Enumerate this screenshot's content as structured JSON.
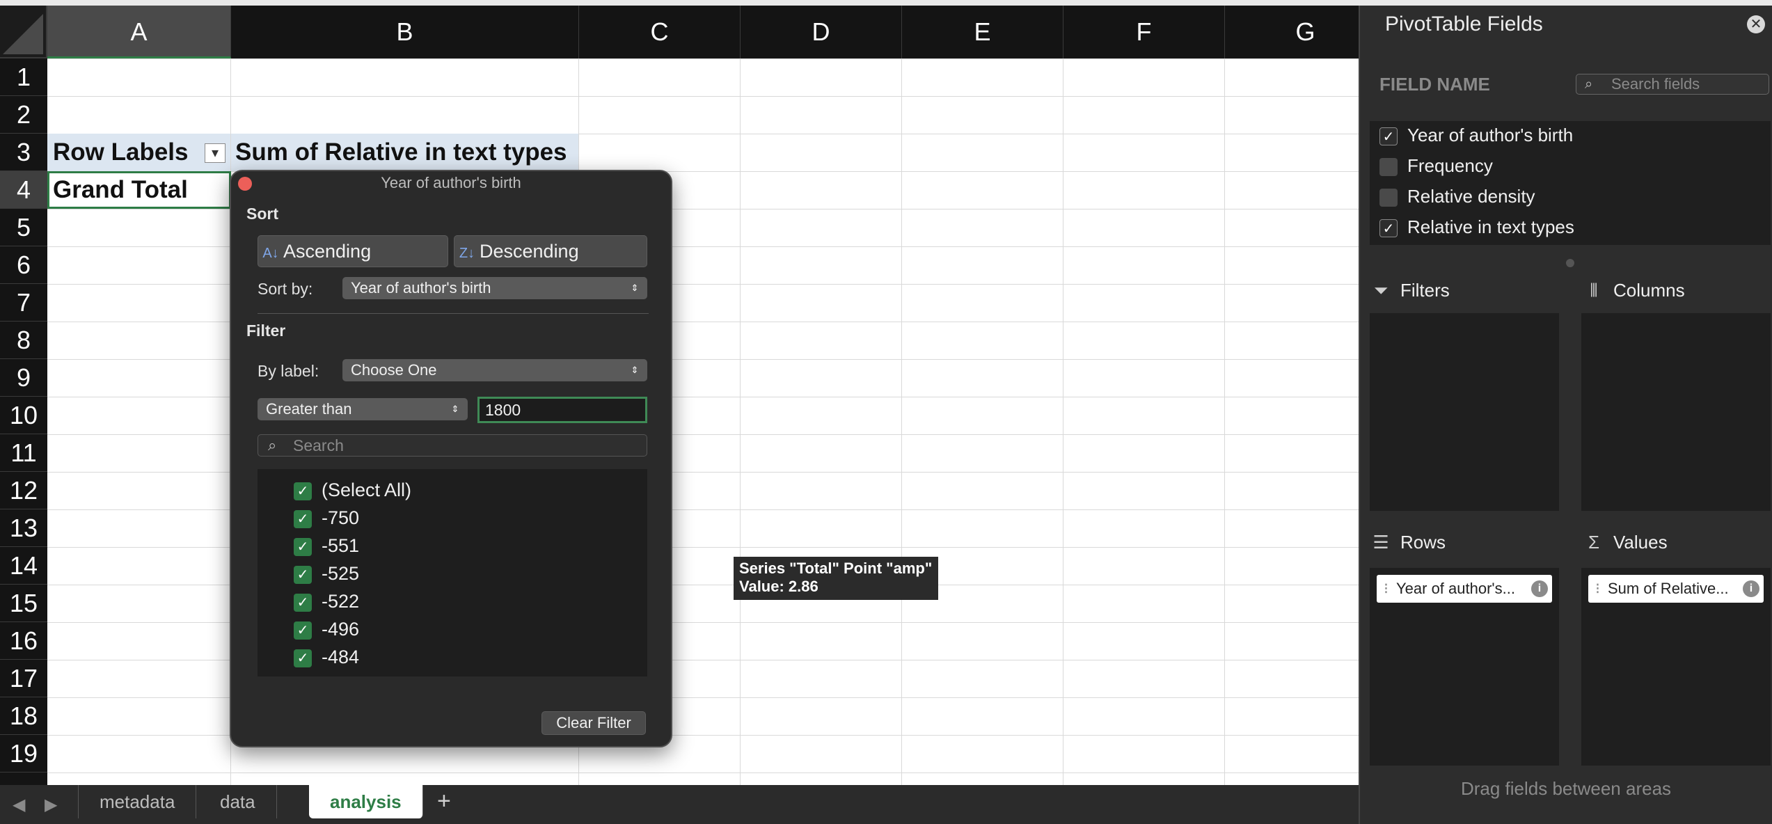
{
  "sheet": {
    "columns": [
      "A",
      "B",
      "C",
      "D",
      "E",
      "F",
      "G"
    ],
    "selected_column": "A",
    "rows": [
      "1",
      "2",
      "3",
      "4",
      "5",
      "6",
      "7",
      "8",
      "9",
      "10",
      "11",
      "12",
      "13",
      "14",
      "15",
      "16",
      "17",
      "18",
      "19"
    ],
    "selected_row": "4",
    "cells": {
      "a3": "Row Labels",
      "b3": "Sum of Relative in text types",
      "a4": "Grand Total"
    }
  },
  "tabs": {
    "items": [
      "metadata",
      "data",
      "analysis"
    ],
    "active": "analysis",
    "add_label": "+"
  },
  "filter_popup": {
    "title": "Year of author's birth",
    "sort_label": "Sort",
    "ascending_label": "Ascending",
    "descending_label": "Descending",
    "sort_by_label": "Sort by:",
    "sort_by_value": "Year of author's birth",
    "filter_label": "Filter",
    "by_label_label": "By label:",
    "by_label_value": "Choose One",
    "condition_value": "Greater than",
    "condition_input": "1800",
    "search_placeholder": "Search",
    "items": [
      {
        "label": "(Select All)",
        "checked": true
      },
      {
        "label": "-750",
        "checked": true
      },
      {
        "label": "-551",
        "checked": true
      },
      {
        "label": "-525",
        "checked": true
      },
      {
        "label": "-522",
        "checked": true
      },
      {
        "label": "-496",
        "checked": true
      },
      {
        "label": "-484",
        "checked": true
      }
    ],
    "clear_filter_label": "Clear Filter"
  },
  "tooltip": {
    "line1": "Series \"Total\" Point \"amp\"",
    "line2": "Value: 2.86"
  },
  "pivot_pane": {
    "title": "PivotTable Fields",
    "field_name_label": "FIELD NAME",
    "search_placeholder": "Search fields",
    "fields": [
      {
        "label": "Year of author's birth",
        "checked": true
      },
      {
        "label": "Frequency",
        "checked": false
      },
      {
        "label": "Relative density",
        "checked": false
      },
      {
        "label": "Relative in text types",
        "checked": true
      }
    ],
    "areas": {
      "filters": "Filters",
      "columns": "Columns",
      "rows": "Rows",
      "values": "Values"
    },
    "rows_chip": "Year of author's...",
    "values_chip": "Sum of Relative...",
    "drag_hint": "Drag fields between areas"
  },
  "icons": {
    "sort_ascending": "sort-ascending-icon",
    "sort_descending": "sort-descending-icon",
    "search": "search-icon",
    "filter_funnel": "funnel-icon",
    "columns": "columns-icon",
    "rows": "rows-icon",
    "values": "sigma-icon",
    "info": "info-icon",
    "close": "close-icon"
  },
  "colors": {
    "accent_green": "#2e7d46",
    "pivot_header": "#dce6f1",
    "close_red": "#ec5f59"
  }
}
